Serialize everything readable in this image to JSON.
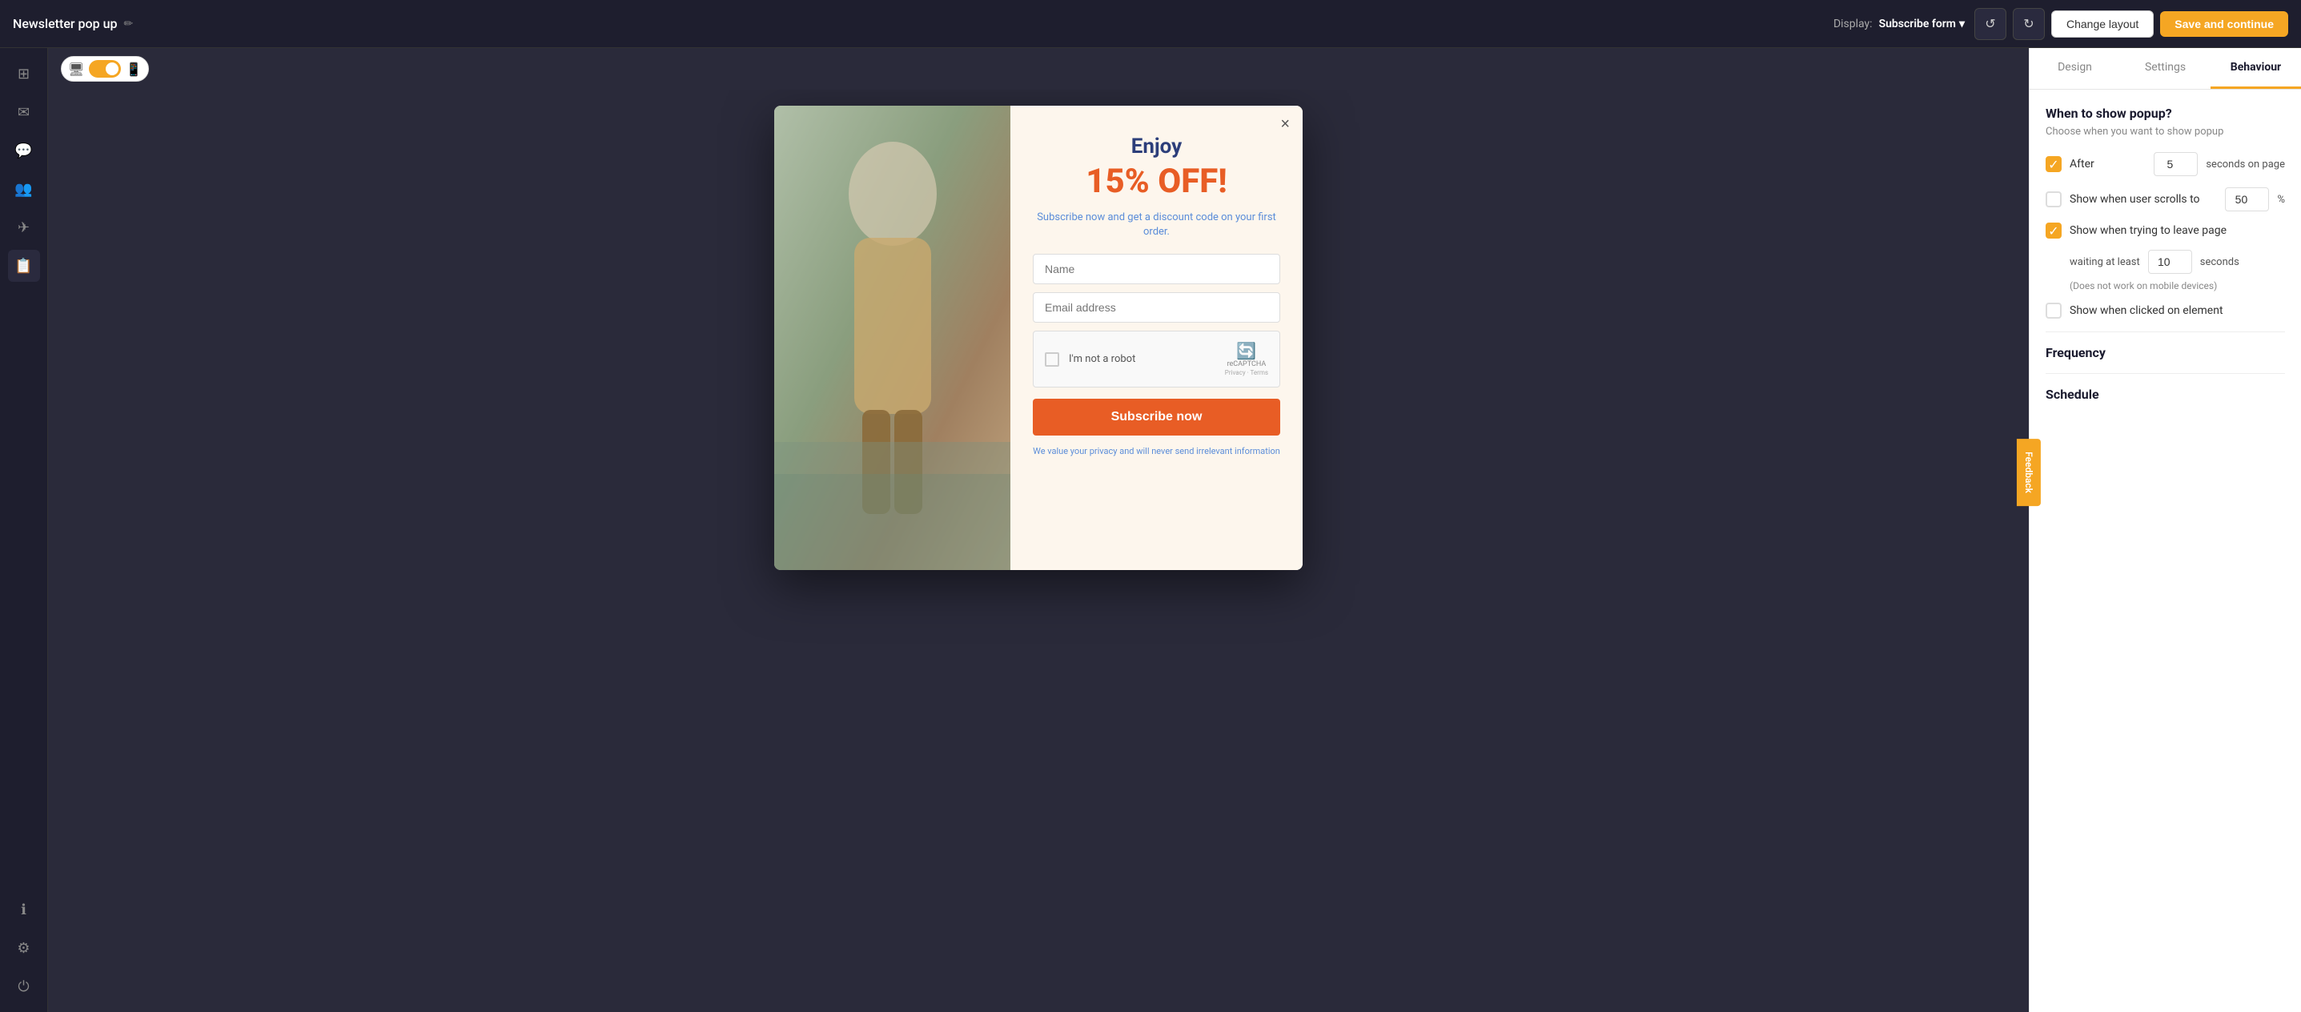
{
  "topbar": {
    "title": "Newsletter pop up",
    "edit_icon": "✏",
    "display_label": "Display:",
    "display_value": "Subscribe form",
    "undo_icon": "↺",
    "redo_icon": "↻",
    "change_layout_label": "Change layout",
    "save_label": "Save and continue"
  },
  "sidebar": {
    "items": [
      {
        "icon": "□",
        "label": "pages",
        "active": false
      },
      {
        "icon": "✉",
        "label": "email",
        "active": false
      },
      {
        "icon": "💬",
        "label": "chat",
        "active": false
      },
      {
        "icon": "👥",
        "label": "contacts",
        "active": false
      },
      {
        "icon": "✈",
        "label": "campaigns",
        "active": false
      },
      {
        "icon": "📋",
        "label": "forms",
        "active": true
      },
      {
        "icon": "ℹ",
        "label": "info",
        "active": false
      },
      {
        "icon": "⚙",
        "label": "settings",
        "active": false
      },
      {
        "icon": "⏻",
        "label": "logout",
        "active": false
      }
    ]
  },
  "preview": {
    "device_desktop_icon": "🖥",
    "device_mobile_icon": "📱",
    "toggle_state": "on"
  },
  "popup": {
    "heading": "Enjoy",
    "discount": "15% OFF!",
    "subtitle": "Subscribe now and get a discount code on your first order.",
    "name_placeholder": "Name",
    "email_placeholder": "Email address",
    "recaptcha_label": "I'm not a robot",
    "recaptcha_badge": "reCAPTCHA\nPrivacy · Terms",
    "subscribe_btn": "Subscribe now",
    "privacy_text": "We value your privacy and will never send irrelevant information",
    "close_icon": "×"
  },
  "panel": {
    "tabs": [
      "Design",
      "Settings",
      "Behaviour"
    ],
    "active_tab": 2,
    "behaviour": {
      "section_title": "When to show popup?",
      "section_desc": "Choose when you want to show popup",
      "options": [
        {
          "id": "after_seconds",
          "checked": true,
          "label_before": "After",
          "value": "5",
          "label_after": "seconds on page"
        },
        {
          "id": "scroll_to",
          "checked": false,
          "label": "Show when user scrolls to",
          "value": "50",
          "unit": "%"
        },
        {
          "id": "leave_page",
          "checked": true,
          "label": "Show when trying to leave page",
          "suboption": {
            "label_before": "waiting at least",
            "value": "10",
            "label_after": "seconds"
          },
          "note": "(Does not work on mobile devices)"
        },
        {
          "id": "click_element",
          "checked": false,
          "label": "Show when clicked on element"
        }
      ],
      "frequency_title": "Frequency",
      "schedule_title": "Schedule"
    }
  },
  "feedback": {
    "label": "Feedback"
  }
}
